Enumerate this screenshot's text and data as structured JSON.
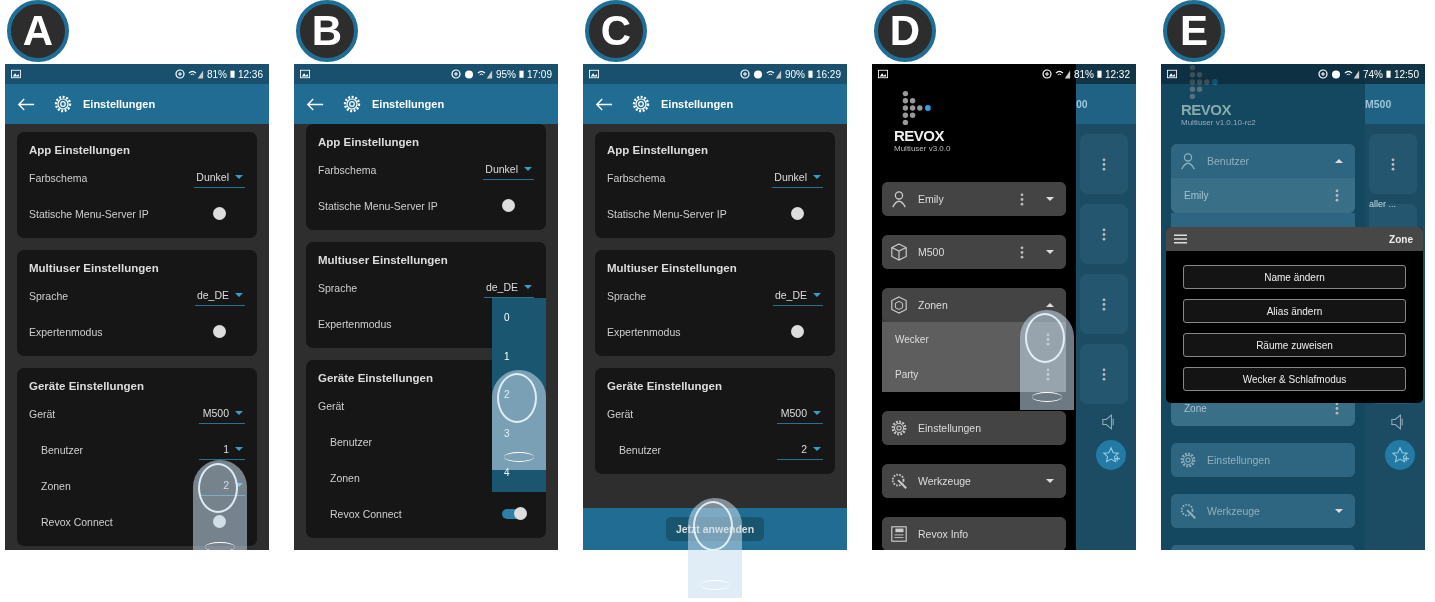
{
  "panels": [
    {
      "label": "A",
      "kind": "settings",
      "status": {
        "alarm": false,
        "battery": "81%",
        "time": "12:36"
      },
      "title": "Einstellungen",
      "sections": [
        {
          "title": "App Einstellungen",
          "rows": [
            {
              "kind": "select",
              "label": "Farbschema",
              "value": "Dunkel"
            },
            {
              "kind": "toggle",
              "label": "Statische Menu-Server IP",
              "on": false
            }
          ]
        },
        {
          "title": "Multiuser Einstellungen",
          "rows": [
            {
              "kind": "select",
              "label": "Sprache",
              "value": "de_DE"
            },
            {
              "kind": "toggle",
              "label": "Expertenmodus",
              "on": false
            }
          ]
        },
        {
          "title": "Geräte Einstellungen",
          "rows": [
            {
              "kind": "select",
              "label": "Gerät",
              "value": "M500",
              "children": [
                {
                  "kind": "select",
                  "label": "Benutzer",
                  "value": "1"
                },
                {
                  "kind": "select",
                  "label": "Zonen",
                  "value": "2",
                  "touched": true
                },
                {
                  "kind": "toggle",
                  "label": "Revox Connect",
                  "on": false
                }
              ]
            }
          ]
        }
      ]
    },
    {
      "label": "B",
      "kind": "settings",
      "status": {
        "alarm": true,
        "battery": "95%",
        "time": "17:09"
      },
      "title": "Einstellungen",
      "sections": [
        {
          "title": "App Einstellungen",
          "rows": [
            {
              "kind": "select",
              "label": "Farbschema",
              "value": "Dunkel"
            },
            {
              "kind": "toggle",
              "label": "Statische Menu-Server IP",
              "on": false
            }
          ]
        },
        {
          "title": "Multiuser Einstellungen",
          "rows": [
            {
              "kind": "select",
              "label": "Sprache",
              "value": "de_DE"
            },
            {
              "kind": "label",
              "label": "Expertenmodus"
            }
          ]
        },
        {
          "title": "Geräte Einstellungen",
          "rows": [
            {
              "kind": "select",
              "label": "Gerät",
              "children": [
                {
                  "kind": "select",
                  "label": "Benutzer",
                  "open": true,
                  "options": [
                    {
                      "label": "0",
                      "touched": false
                    },
                    {
                      "label": "1",
                      "touched": false
                    },
                    {
                      "label": "2",
                      "touched": true
                    },
                    {
                      "label": "3",
                      "touched": false
                    },
                    {
                      "label": "4",
                      "touched": false
                    }
                  ]
                },
                {
                  "kind": "select",
                  "label": "Zonen"
                },
                {
                  "kind": "toggle",
                  "label": "Revox Connect",
                  "on": true
                }
              ]
            }
          ]
        }
      ]
    },
    {
      "label": "C",
      "kind": "settings",
      "status": {
        "alarm": true,
        "battery": "90%",
        "time": "16:29"
      },
      "title": "Einstellungen",
      "sections": [
        {
          "title": "App Einstellungen",
          "rows": [
            {
              "kind": "select",
              "label": "Farbschema",
              "value": "Dunkel"
            },
            {
              "kind": "toggle",
              "label": "Statische Menu-Server IP",
              "on": false
            }
          ]
        },
        {
          "title": "Multiuser Einstellungen",
          "rows": [
            {
              "kind": "select",
              "label": "Sprache",
              "value": "de_DE"
            },
            {
              "kind": "toggle",
              "label": "Expertenmodus",
              "on": false
            }
          ]
        },
        {
          "title": "Geräte Einstellungen",
          "rows": [
            {
              "kind": "select",
              "label": "Gerät",
              "value": "M500",
              "children": [
                {
                  "kind": "select",
                  "label": "Benutzer",
                  "value": "2"
                }
              ]
            }
          ]
        }
      ],
      "action": {
        "label": "Jetzt anwenden",
        "touched": true
      }
    },
    {
      "label": "D",
      "kind": "drawer",
      "dimmed": false,
      "status": {
        "alarm": false,
        "battery": "81%",
        "time": "12:32"
      },
      "logo": {
        "name": "REVOX",
        "version": "Multiuser v3.0.0"
      },
      "background": {
        "title": "00"
      },
      "menu": [
        {
          "kind": "user",
          "label": "Emily",
          "menu": true,
          "expanded": false
        },
        {
          "kind": "device",
          "label": "M500",
          "menu": true,
          "expanded": false
        },
        {
          "kind": "zones",
          "label": "Zonen",
          "expanded": true,
          "children": [
            {
              "label": "Wecker",
              "menu": true,
              "touched": true
            },
            {
              "label": "Party",
              "menu": true,
              "touched": false
            }
          ]
        },
        {
          "kind": "settings",
          "label": "Einstellungen"
        },
        {
          "kind": "tools",
          "label": "Werkzeuge",
          "expanded": false
        },
        {
          "kind": "info",
          "label": "Revox Info"
        }
      ]
    },
    {
      "label": "E",
      "kind": "drawer",
      "dimmed": true,
      "status": {
        "alarm": true,
        "battery": "74%",
        "time": "12:50"
      },
      "logo": {
        "name": "REVOX",
        "version": "Multiuser v1.0.10-rc2"
      },
      "background": {
        "title": "M500",
        "snippet": "aller ..."
      },
      "menu": [
        {
          "kind": "user",
          "label": "Benutzer",
          "expanded": true,
          "children": [
            {
              "label": "Emily",
              "menu": true,
              "touched": false
            }
          ]
        },
        {
          "kind": "covered",
          "children": [
            {
              "label": "Zone",
              "menu": true,
              "touched": false
            }
          ]
        },
        {
          "kind": "settings",
          "label": "Einstellungen"
        },
        {
          "kind": "tools",
          "label": "Werkzeuge",
          "expanded": false
        },
        {
          "kind": "blank"
        }
      ],
      "dialog": {
        "title": "Zone",
        "buttons": [
          "Name ändern",
          "Alias ändern",
          "Räume zuweisen",
          "Wecker & Schlafmodus"
        ]
      }
    }
  ]
}
